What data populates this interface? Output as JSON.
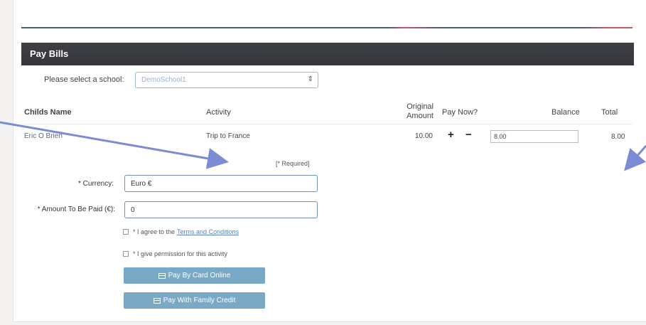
{
  "panel": {
    "title": "Pay Bills"
  },
  "school": {
    "label": "Please select a school:",
    "selected": "DemoSchool1"
  },
  "table": {
    "headers": {
      "childs_name": "Childs Name",
      "activity": "Activity",
      "original_line1": "Original",
      "original_line2": "Amount",
      "pay_now": "Pay Now?",
      "balance": "Balance",
      "total": "Total"
    },
    "rows": [
      {
        "child": "Eric O Brien",
        "activity": "Trip to France",
        "original_amount": "10.00",
        "plus": "+",
        "minus": "−",
        "balance": "8.00",
        "total": "8.00"
      }
    ]
  },
  "form": {
    "required_note": "[* Required]",
    "currency_label": "* Currency:",
    "currency_value": "Euro €",
    "amount_label": "* Amount To Be Paid (€):",
    "amount_value": "0",
    "agree_text": "* I agree to the",
    "terms_link": "Terms and Conditions",
    "permission_text": "* I give permission for this activity",
    "pay_card_label": "Pay By Card Online",
    "pay_credit_label": "Pay With Family Credit"
  },
  "colors": {
    "header_bg": "#3a3c41",
    "button_bg": "#79a9c4",
    "arrow": "#7b8bd4",
    "link": "#5b7fb8"
  },
  "icons": [
    "credit-card-icon",
    "caret-updown-icon",
    "arrow-icon"
  ]
}
